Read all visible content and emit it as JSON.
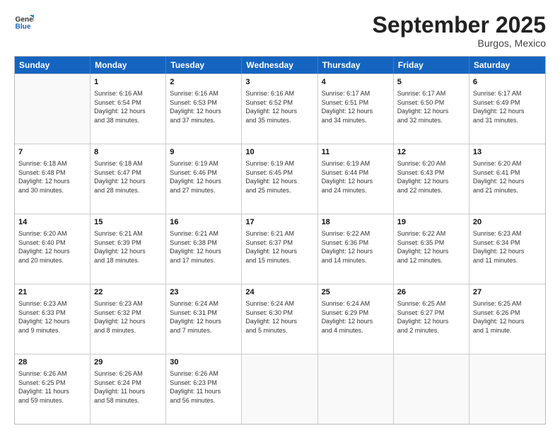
{
  "logo": {
    "line1": "General",
    "line2": "Blue"
  },
  "title": "September 2025",
  "subtitle": "Burgos, Mexico",
  "header_days": [
    "Sunday",
    "Monday",
    "Tuesday",
    "Wednesday",
    "Thursday",
    "Friday",
    "Saturday"
  ],
  "weeks": [
    [
      {
        "day": "",
        "info": ""
      },
      {
        "day": "1",
        "info": "Sunrise: 6:16 AM\nSunset: 6:54 PM\nDaylight: 12 hours\nand 38 minutes."
      },
      {
        "day": "2",
        "info": "Sunrise: 6:16 AM\nSunset: 6:53 PM\nDaylight: 12 hours\nand 37 minutes."
      },
      {
        "day": "3",
        "info": "Sunrise: 6:16 AM\nSunset: 6:52 PM\nDaylight: 12 hours\nand 35 minutes."
      },
      {
        "day": "4",
        "info": "Sunrise: 6:17 AM\nSunset: 6:51 PM\nDaylight: 12 hours\nand 34 minutes."
      },
      {
        "day": "5",
        "info": "Sunrise: 6:17 AM\nSunset: 6:50 PM\nDaylight: 12 hours\nand 32 minutes."
      },
      {
        "day": "6",
        "info": "Sunrise: 6:17 AM\nSunset: 6:49 PM\nDaylight: 12 hours\nand 31 minutes."
      }
    ],
    [
      {
        "day": "7",
        "info": "Sunrise: 6:18 AM\nSunset: 6:48 PM\nDaylight: 12 hours\nand 30 minutes."
      },
      {
        "day": "8",
        "info": "Sunrise: 6:18 AM\nSunset: 6:47 PM\nDaylight: 12 hours\nand 28 minutes."
      },
      {
        "day": "9",
        "info": "Sunrise: 6:19 AM\nSunset: 6:46 PM\nDaylight: 12 hours\nand 27 minutes."
      },
      {
        "day": "10",
        "info": "Sunrise: 6:19 AM\nSunset: 6:45 PM\nDaylight: 12 hours\nand 25 minutes."
      },
      {
        "day": "11",
        "info": "Sunrise: 6:19 AM\nSunset: 6:44 PM\nDaylight: 12 hours\nand 24 minutes."
      },
      {
        "day": "12",
        "info": "Sunrise: 6:20 AM\nSunset: 6:43 PM\nDaylight: 12 hours\nand 22 minutes."
      },
      {
        "day": "13",
        "info": "Sunrise: 6:20 AM\nSunset: 6:41 PM\nDaylight: 12 hours\nand 21 minutes."
      }
    ],
    [
      {
        "day": "14",
        "info": "Sunrise: 6:20 AM\nSunset: 6:40 PM\nDaylight: 12 hours\nand 20 minutes."
      },
      {
        "day": "15",
        "info": "Sunrise: 6:21 AM\nSunset: 6:39 PM\nDaylight: 12 hours\nand 18 minutes."
      },
      {
        "day": "16",
        "info": "Sunrise: 6:21 AM\nSunset: 6:38 PM\nDaylight: 12 hours\nand 17 minutes."
      },
      {
        "day": "17",
        "info": "Sunrise: 6:21 AM\nSunset: 6:37 PM\nDaylight: 12 hours\nand 15 minutes."
      },
      {
        "day": "18",
        "info": "Sunrise: 6:22 AM\nSunset: 6:36 PM\nDaylight: 12 hours\nand 14 minutes."
      },
      {
        "day": "19",
        "info": "Sunrise: 6:22 AM\nSunset: 6:35 PM\nDaylight: 12 hours\nand 12 minutes."
      },
      {
        "day": "20",
        "info": "Sunrise: 6:23 AM\nSunset: 6:34 PM\nDaylight: 12 hours\nand 11 minutes."
      }
    ],
    [
      {
        "day": "21",
        "info": "Sunrise: 6:23 AM\nSunset: 6:33 PM\nDaylight: 12 hours\nand 9 minutes."
      },
      {
        "day": "22",
        "info": "Sunrise: 6:23 AM\nSunset: 6:32 PM\nDaylight: 12 hours\nand 8 minutes."
      },
      {
        "day": "23",
        "info": "Sunrise: 6:24 AM\nSunset: 6:31 PM\nDaylight: 12 hours\nand 7 minutes."
      },
      {
        "day": "24",
        "info": "Sunrise: 6:24 AM\nSunset: 6:30 PM\nDaylight: 12 hours\nand 5 minutes."
      },
      {
        "day": "25",
        "info": "Sunrise: 6:24 AM\nSunset: 6:29 PM\nDaylight: 12 hours\nand 4 minutes."
      },
      {
        "day": "26",
        "info": "Sunrise: 6:25 AM\nSunset: 6:27 PM\nDaylight: 12 hours\nand 2 minutes."
      },
      {
        "day": "27",
        "info": "Sunrise: 6:25 AM\nSunset: 6:26 PM\nDaylight: 12 hours\nand 1 minute."
      }
    ],
    [
      {
        "day": "28",
        "info": "Sunrise: 6:26 AM\nSunset: 6:25 PM\nDaylight: 11 hours\nand 59 minutes."
      },
      {
        "day": "29",
        "info": "Sunrise: 6:26 AM\nSunset: 6:24 PM\nDaylight: 11 hours\nand 58 minutes."
      },
      {
        "day": "30",
        "info": "Sunrise: 6:26 AM\nSunset: 6:23 PM\nDaylight: 11 hours\nand 56 minutes."
      },
      {
        "day": "",
        "info": ""
      },
      {
        "day": "",
        "info": ""
      },
      {
        "day": "",
        "info": ""
      },
      {
        "day": "",
        "info": ""
      }
    ]
  ]
}
